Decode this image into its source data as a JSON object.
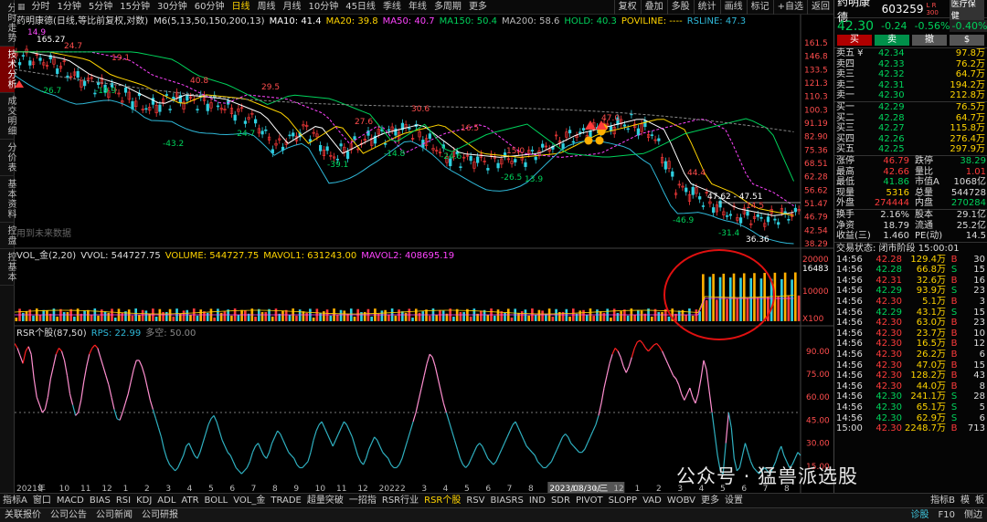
{
  "vtabs": [
    "分时走势",
    "技术分析",
    "成交明细",
    "分价表",
    "基本资料",
    "控盘",
    "控基本"
  ],
  "vtab_active": 1,
  "periods": [
    "分时",
    "1分钟",
    "5分钟",
    "15分钟",
    "30分钟",
    "60分钟",
    "日线",
    "周线",
    "月线",
    "10分钟",
    "45日线",
    "季线",
    "年线",
    "多周期",
    "更多"
  ],
  "period_active": 6,
  "toolbar": [
    "复权",
    "叠加",
    "多股",
    "统计",
    "画线",
    "标记",
    "+自选",
    "返回"
  ],
  "kline_title": {
    "name": "药明康德(日线,等比前复权,对数)",
    "ma": [
      {
        "t": "M6(5,13,50,150,200,13)",
        "c": "#dddddd"
      },
      {
        "t": "MA10: 41.4",
        "c": "#ffffff"
      },
      {
        "t": "MA20: 39.8",
        "c": "#ffd400"
      },
      {
        "t": "MA50: 40.7",
        "c": "#ff44ff"
      },
      {
        "t": "MA150: 50.4",
        "c": "#00d25b"
      },
      {
        "t": "MA200: 58.6",
        "c": "#bbbbbb"
      },
      {
        "t": "HOLD: 40.3",
        "c": "#00d25b"
      },
      {
        "t": "POVILINE: ----",
        "c": "#ffd400"
      },
      {
        "t": "RSLINE: 47.3",
        "c": "#2fb8d8"
      }
    ]
  },
  "price_scale": [
    "161.5",
    "146.8",
    "133.5",
    "121.3",
    "110.3",
    "100.3",
    "91.19",
    "82.90",
    "75.36",
    "68.51",
    "62.28",
    "56.62",
    "51.47",
    "46.79",
    "42.54",
    "38.29"
  ],
  "price_labels": [
    {
      "t": "165.27",
      "c": "#ffffff"
    },
    {
      "t": "14.9",
      "c": "#ff4dff"
    },
    {
      "t": "24.7",
      "c": "#ff4d4d"
    },
    {
      "t": "19.1",
      "c": "#ff4d4d"
    },
    {
      "t": "-26.7",
      "c": "#00d25b"
    },
    {
      "t": "-19.9",
      "c": "#00d25b"
    },
    {
      "t": "40.8",
      "c": "#ff4d4d"
    },
    {
      "t": "29.5",
      "c": "#ff4d4d"
    },
    {
      "t": "-43.2",
      "c": "#00d25b"
    },
    {
      "t": "-24.7",
      "c": "#00d25b"
    },
    {
      "t": "27.6",
      "c": "#ff4d4d"
    },
    {
      "t": "30.6",
      "c": "#ff4d4d"
    },
    {
      "t": "-39.1",
      "c": "#00d25b"
    },
    {
      "t": "-14.8",
      "c": "#00d25b"
    },
    {
      "t": "16.5",
      "c": "#ff4d4d"
    },
    {
      "t": "-24.6",
      "c": "#00d25b"
    },
    {
      "t": "15.0",
      "c": "#ff4d4d"
    },
    {
      "t": "-26.5",
      "c": "#00d25b"
    },
    {
      "t": "13.9",
      "c": "#00d25b"
    },
    {
      "t": "47.0",
      "c": "#ff4d4d"
    },
    {
      "t": "44.4",
      "c": "#ff4d4d"
    },
    {
      "t": "47.62 - 47.51",
      "c": "#ffffff"
    },
    {
      "t": "14.5",
      "c": "#ff4d4d"
    },
    {
      "t": "-46.9",
      "c": "#00d25b"
    },
    {
      "t": "-31.4",
      "c": "#00d25b"
    },
    {
      "t": "36.36",
      "c": "#ffffff"
    }
  ],
  "future_note": "用到未来数据",
  "vol_title": [
    {
      "t": "VOL_金(2,20)",
      "c": "#dddddd"
    },
    {
      "t": "VVOL: 544727.75",
      "c": "#dddddd"
    },
    {
      "t": "VOLUME: 544727.75",
      "c": "#ffd400"
    },
    {
      "t": "MAVOL1: 631243.00",
      "c": "#ffd400"
    },
    {
      "t": "MAVOL2: 408695.19",
      "c": "#ff44ff"
    }
  ],
  "vol_scale": [
    "20000",
    "16483",
    "10000",
    "X100"
  ],
  "rsr_title": [
    {
      "t": "RSR个股(87,50)",
      "c": "#dddddd"
    },
    {
      "t": "RPS: 22.99",
      "c": "#2fb8d8"
    },
    {
      "t": "多空: 50.00",
      "c": "#888888"
    }
  ],
  "rsr_scale": [
    "90.00",
    "75.00",
    "60.00",
    "45.00",
    "30.00",
    "15.00"
  ],
  "x_labels": [
    "2021年",
    "9",
    "10",
    "11",
    "12",
    "1",
    "2",
    "3",
    "4",
    "5",
    "6",
    "7",
    "8",
    "9",
    "10",
    "11",
    "12",
    "2022",
    "2",
    "3",
    "4",
    "5",
    "6",
    "7",
    "8",
    "2023/08/30/三",
    "10",
    "11",
    "12",
    "1",
    "2",
    "3",
    "4",
    "5",
    "6",
    "7",
    "8"
  ],
  "quote": {
    "name": "药明康德",
    "code": "603259",
    "tags": "L R 300",
    "tag2": "医疗保健",
    "price": "42.30",
    "change": "-0.24",
    "pct": "-0.56%",
    "pct2": "-0.40%",
    "btns": [
      "买",
      "卖",
      "撤",
      "$"
    ],
    "asks": [
      {
        "l": "卖五 ¥",
        "p": "42.34",
        "v": "97.8万"
      },
      {
        "l": "卖四",
        "p": "42.33",
        "v": "76.2万"
      },
      {
        "l": "卖三",
        "p": "42.32",
        "v": "64.7万"
      },
      {
        "l": "卖二",
        "p": "42.31",
        "v": "194.2万"
      },
      {
        "l": "卖一",
        "p": "42.30",
        "v": "212.8万"
      }
    ],
    "bids": [
      {
        "l": "买一",
        "p": "42.29",
        "v": "76.5万"
      },
      {
        "l": "买二",
        "p": "42.28",
        "v": "64.7万"
      },
      {
        "l": "买三",
        "p": "42.27",
        "v": "115.8万"
      },
      {
        "l": "买四",
        "p": "42.26",
        "v": "276.4万"
      },
      {
        "l": "买五",
        "p": "42.25",
        "v": "297.9万"
      }
    ],
    "stats": [
      [
        {
          "t": "涨停",
          "c": "white"
        },
        {
          "t": "46.79",
          "c": "red"
        },
        {
          "t": "跌停",
          "c": "white"
        },
        {
          "t": "38.29",
          "c": "green"
        }
      ],
      [
        {
          "t": "最高",
          "c": "white"
        },
        {
          "t": "42.66",
          "c": "red"
        },
        {
          "t": "量比",
          "c": "white"
        },
        {
          "t": "1.01",
          "c": "red"
        }
      ],
      [
        {
          "t": "最低",
          "c": "white"
        },
        {
          "t": "41.86",
          "c": "green"
        },
        {
          "t": "市值A",
          "c": "white"
        },
        {
          "t": "1068亿",
          "c": "white"
        }
      ],
      [
        {
          "t": "现量",
          "c": "white"
        },
        {
          "t": "5316",
          "c": "yellow"
        },
        {
          "t": "总量",
          "c": "white"
        },
        {
          "t": "544728",
          "c": "white"
        }
      ],
      [
        {
          "t": "外盘",
          "c": "white"
        },
        {
          "t": "274444",
          "c": "red"
        },
        {
          "t": "内盘",
          "c": "white"
        },
        {
          "t": "270284",
          "c": "green"
        }
      ]
    ],
    "stats2": [
      [
        {
          "t": "换手",
          "c": "white"
        },
        {
          "t": "2.16%",
          "c": "white"
        },
        {
          "t": "股本",
          "c": "white"
        },
        {
          "t": "29.1亿",
          "c": "white"
        }
      ],
      [
        {
          "t": "净资",
          "c": "white"
        },
        {
          "t": "18.79",
          "c": "white"
        },
        {
          "t": "流通",
          "c": "white"
        },
        {
          "t": "25.2亿",
          "c": "white"
        }
      ],
      [
        {
          "t": "收益(三)",
          "c": "white"
        },
        {
          "t": "1.460",
          "c": "white"
        },
        {
          "t": "PE(动)",
          "c": "white"
        },
        {
          "t": "14.5",
          "c": "white"
        }
      ]
    ],
    "trade_status": "交易状态: 闭市阶段 15:00:01",
    "ticks": [
      {
        "t": "14:56",
        "p": "42.28",
        "v": "129.4万",
        "s": "B",
        "n": "30"
      },
      {
        "t": "14:56",
        "p": "42.28",
        "v": "66.8万",
        "s": "S",
        "n": "15"
      },
      {
        "t": "14:56",
        "p": "42.31",
        "v": "32.6万",
        "s": "B",
        "n": "16"
      },
      {
        "t": "14:56",
        "p": "42.29",
        "v": "93.9万",
        "s": "S",
        "n": "23"
      },
      {
        "t": "14:56",
        "p": "42.30",
        "v": "5.1万",
        "s": "B",
        "n": "3"
      },
      {
        "t": "14:56",
        "p": "42.29",
        "v": "43.1万",
        "s": "S",
        "n": "15"
      },
      {
        "t": "14:56",
        "p": "42.30",
        "v": "63.0万",
        "s": "B",
        "n": "23"
      },
      {
        "t": "14:56",
        "p": "42.30",
        "v": "23.7万",
        "s": "B",
        "n": "10"
      },
      {
        "t": "14:56",
        "p": "42.30",
        "v": "16.5万",
        "s": "B",
        "n": "12"
      },
      {
        "t": "14:56",
        "p": "42.30",
        "v": "26.2万",
        "s": "B",
        "n": "6"
      },
      {
        "t": "14:56",
        "p": "42.30",
        "v": "47.0万",
        "s": "B",
        "n": "15"
      },
      {
        "t": "14:56",
        "p": "42.30",
        "v": "128.2万",
        "s": "B",
        "n": "43"
      },
      {
        "t": "14:56",
        "p": "42.30",
        "v": "44.0万",
        "s": "B",
        "n": "8"
      },
      {
        "t": "14:56",
        "p": "42.30",
        "v": "241.1万",
        "s": "S",
        "n": "28"
      },
      {
        "t": "14:56",
        "p": "42.30",
        "v": "65.1万",
        "s": "S",
        "n": "5"
      },
      {
        "t": "14:56",
        "p": "42.30",
        "v": "62.9万",
        "s": "S",
        "n": "6"
      },
      {
        "t": "15:00",
        "p": "42.30",
        "v": "2248.7万",
        "s": "B",
        "n": "713"
      }
    ]
  },
  "bottom_tabs": [
    "指标A",
    "窗口",
    "MACD",
    "BIAS",
    "RSI",
    "KDJ",
    "ADL",
    "ATR",
    "BOLL",
    "VOL_金",
    "TRADE",
    "超量突破",
    "一招指",
    "RSR行业",
    "RSR个股",
    "RSV",
    "BIASRS",
    "IND",
    "SDR",
    "PIVOT",
    "SLOPP",
    "VAD",
    "WOBV",
    "更多",
    "设置"
  ],
  "bottom_tab_active": "RSR个股",
  "bottom_right": [
    "指标B",
    "模",
    "板"
  ],
  "status": [
    "关联报价",
    "公司公告",
    "公司新闻",
    "公司研报"
  ],
  "status_right": [
    "诊股",
    "F10",
    "侧边"
  ],
  "watermark": "公众号 · 猛兽派选股",
  "rsr_series": [
    95,
    92,
    87,
    82,
    90,
    93,
    88,
    72,
    60,
    55,
    50,
    52,
    60,
    72,
    80,
    88,
    92,
    90,
    84,
    74,
    62,
    55,
    48,
    50,
    58,
    70,
    80,
    88,
    92,
    94,
    92,
    86,
    80,
    74,
    68,
    60,
    52,
    46,
    45,
    50,
    56,
    62,
    70,
    78,
    84,
    84,
    80,
    74,
    66,
    58,
    52,
    46,
    40,
    34,
    26,
    20,
    16,
    14,
    12,
    14,
    18,
    22,
    28,
    30,
    26,
    22,
    20,
    24,
    30,
    36,
    42,
    46,
    48,
    44,
    38,
    32,
    28,
    24,
    22,
    18,
    14,
    12,
    10,
    12,
    14,
    18,
    24,
    28,
    30,
    26,
    22,
    20,
    24,
    30,
    34,
    38,
    36,
    32,
    28,
    24,
    22,
    20,
    16,
    14,
    14,
    16,
    18,
    24,
    32,
    38,
    42,
    44,
    40,
    36,
    32,
    28,
    32,
    36,
    40,
    44,
    42,
    38,
    34,
    28,
    22,
    18,
    16,
    20,
    26,
    30,
    34,
    32,
    28,
    24,
    22,
    20,
    16,
    14,
    14,
    16,
    20,
    26,
    32,
    38,
    44,
    50,
    58,
    66,
    74,
    82,
    88,
    86,
    80,
    72,
    64,
    56,
    50,
    44,
    38,
    32,
    26,
    20,
    16,
    14,
    16,
    20,
    24,
    28,
    30,
    28,
    24,
    20,
    18,
    16,
    18,
    22,
    26,
    30,
    34,
    38,
    42,
    44,
    40,
    36,
    32,
    28,
    26,
    24,
    22,
    18,
    16,
    14,
    14,
    16,
    18,
    22,
    26,
    30,
    34,
    36,
    34,
    30,
    28,
    26,
    24,
    24,
    26,
    30,
    34,
    38,
    42,
    48,
    56,
    66,
    74,
    82,
    88,
    92,
    90,
    86,
    80,
    76,
    80,
    86,
    92,
    96,
    97,
    95,
    92,
    90,
    92,
    94,
    95,
    93,
    90,
    86,
    82,
    78,
    74,
    72,
    68,
    62,
    58,
    62,
    66,
    60,
    56,
    62,
    72,
    84,
    78,
    64,
    50,
    36,
    22,
    12,
    10,
    30,
    50,
    40,
    20,
    12,
    14,
    22,
    30,
    24,
    18,
    14,
    12,
    10,
    12,
    14,
    12,
    10,
    14,
    18,
    24,
    28,
    22,
    18,
    14,
    16,
    20,
    24,
    22
  ]
}
